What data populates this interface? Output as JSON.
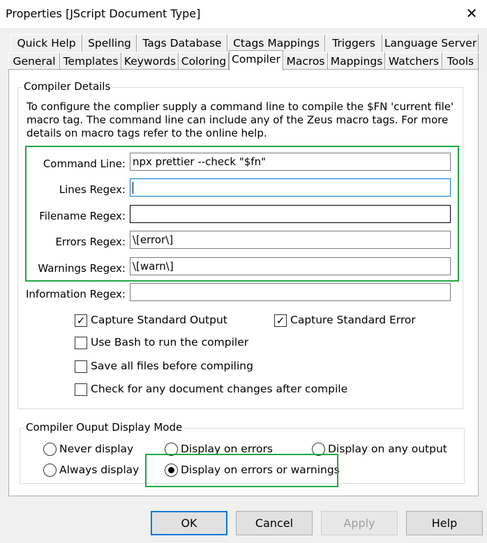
{
  "window": {
    "title": "Properties [JScript Document Type]",
    "close_glyph": "✕"
  },
  "tabs": {
    "row1": [
      "Quick Help",
      "Spelling",
      "Tags Database",
      "Ctags Mappings",
      "Triggers",
      "Language Server"
    ],
    "row2": [
      "General",
      "Templates",
      "Keywords",
      "Coloring",
      "Compiler",
      "Macros",
      "Mappings",
      "Watchers",
      "Tools"
    ],
    "active": "Compiler"
  },
  "compiler_details": {
    "legend": "Compiler Details",
    "description": [
      "To configure the complier supply a command line to compile the $FN 'current file'",
      "macro tag. The command line can include any of the Zeus macro tags. For more",
      "details on macro tags refer to the online help."
    ],
    "fields": [
      {
        "label": "Command Line:",
        "value": "npx prettier --check \"$fn\""
      },
      {
        "label": "Lines Regex:",
        "value": ""
      },
      {
        "label": "Filename Regex:",
        "value": ""
      },
      {
        "label": "Errors Regex:",
        "value": "\\[error\\]"
      },
      {
        "label": "Warnings Regex:",
        "value": "\\[warn\\]"
      },
      {
        "label": "Information Regex:",
        "value": ""
      }
    ],
    "checkboxes": [
      {
        "label": "Capture Standard Output",
        "checked": true
      },
      {
        "label": "Capture Standard Error",
        "checked": true
      },
      {
        "label": "Use Bash to run the compiler",
        "checked": false
      },
      {
        "label": "Save all files before compiling",
        "checked": false
      },
      {
        "label": "Check for any document changes after compile",
        "checked": false
      }
    ],
    "check_glyph": "✓"
  },
  "display_mode": {
    "legend": "Compiler Ouput Display Mode",
    "options": [
      {
        "label": "Never display",
        "selected": false
      },
      {
        "label": "Display on errors",
        "selected": false
      },
      {
        "label": "Display on any output",
        "selected": false
      },
      {
        "label": "Always display",
        "selected": false
      },
      {
        "label": "Display on errors or warnings",
        "selected": true
      }
    ]
  },
  "buttons": {
    "ok": "OK",
    "cancel": "Cancel",
    "apply": "Apply",
    "help": "Help"
  },
  "colors": {
    "highlight": "#22a842",
    "focus_border": "#0078d7"
  }
}
